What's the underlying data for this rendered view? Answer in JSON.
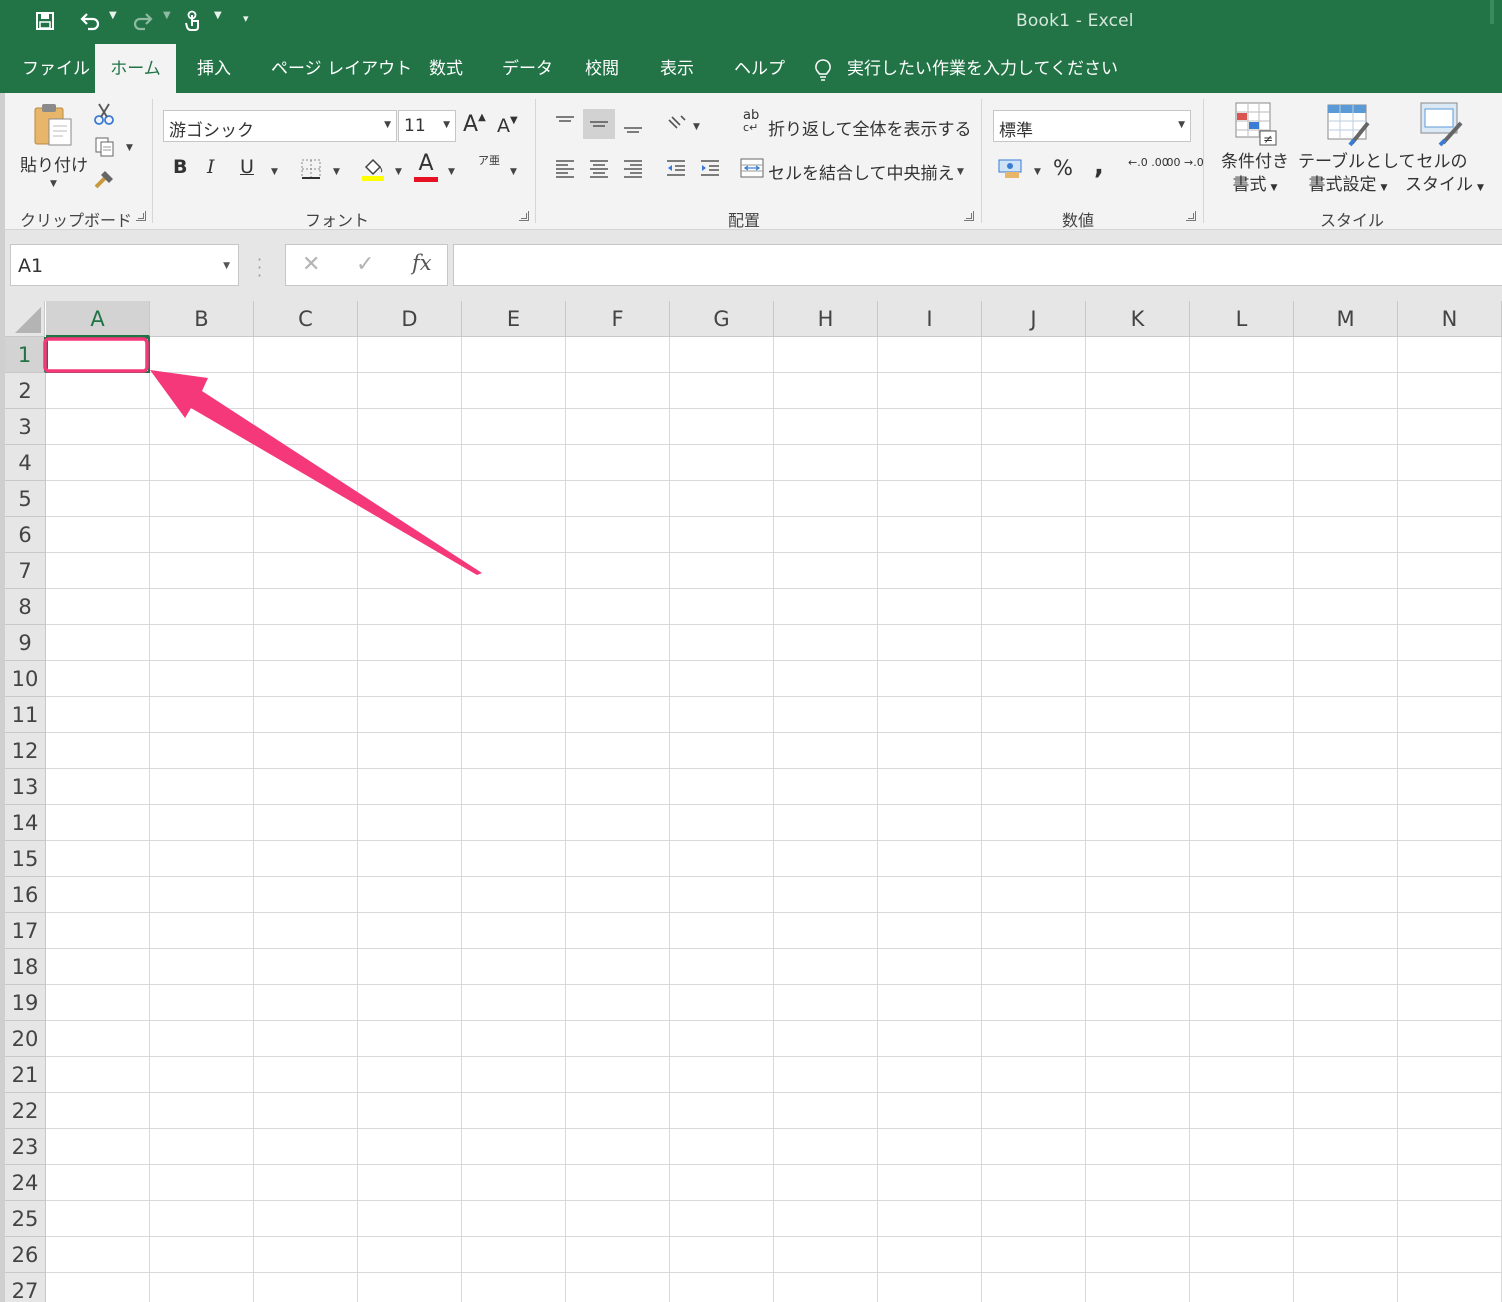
{
  "window": {
    "title": "Book1  -  Excel"
  },
  "tabs": [
    {
      "label": "ファイル",
      "active": false
    },
    {
      "label": "ホーム",
      "active": true
    },
    {
      "label": "挿入",
      "active": false
    },
    {
      "label": "ページ レイアウト",
      "active": false
    },
    {
      "label": "数式",
      "active": false
    },
    {
      "label": "データ",
      "active": false
    },
    {
      "label": "校閲",
      "active": false
    },
    {
      "label": "表示",
      "active": false
    },
    {
      "label": "ヘルプ",
      "active": false
    }
  ],
  "tell_me": {
    "text": "実行したい作業を入力してください"
  },
  "ribbon": {
    "clipboard": {
      "label": "クリップボード",
      "paste_label": "貼り付け"
    },
    "font": {
      "label": "フォント",
      "font_name": "游ゴシック",
      "font_size": "11",
      "grow_label": "A",
      "shrink_label": "A",
      "bold": "B",
      "italic": "I",
      "underline": "U",
      "font_color_letter": "A",
      "font_color": "#e81123",
      "fill_color": "#ffff00",
      "phonetic_label": "ア亜"
    },
    "alignment": {
      "label": "配置",
      "wrap_text": "折り返して全体を表示する",
      "merge_center": "セルを結合して中央揃え",
      "wrap_icon_text": "ab"
    },
    "number": {
      "label": "数値",
      "format": "標準",
      "percent": "%",
      "comma": ",",
      "inc_decimal": "←.0 .00",
      "dec_decimal": ".00 →.0"
    },
    "styles": {
      "label": "スタイル",
      "conditional_line1": "条件付き",
      "conditional_line2": "書式",
      "table_line1": "テーブルとして",
      "table_line2": "書式設定",
      "cell_line1": "セルの",
      "cell_line2": "スタイル"
    }
  },
  "formula_bar": {
    "name_box": "A1",
    "cancel": "✕",
    "enter": "✓",
    "fx": "fx",
    "content": ""
  },
  "sheet": {
    "columns": [
      "A",
      "B",
      "C",
      "D",
      "E",
      "F",
      "G",
      "H",
      "I",
      "J",
      "K",
      "L",
      "M",
      "N"
    ],
    "rows": [
      "1",
      "2",
      "3",
      "4",
      "5",
      "6",
      "7",
      "8",
      "9",
      "10",
      "11",
      "12",
      "13",
      "14",
      "15",
      "16",
      "17",
      "18",
      "19",
      "20",
      "21",
      "22",
      "23",
      "24",
      "25",
      "26",
      "27"
    ],
    "active_cell": "A1"
  },
  "colors": {
    "accent": "#227447",
    "highlight_annotation": "#f5387a"
  }
}
